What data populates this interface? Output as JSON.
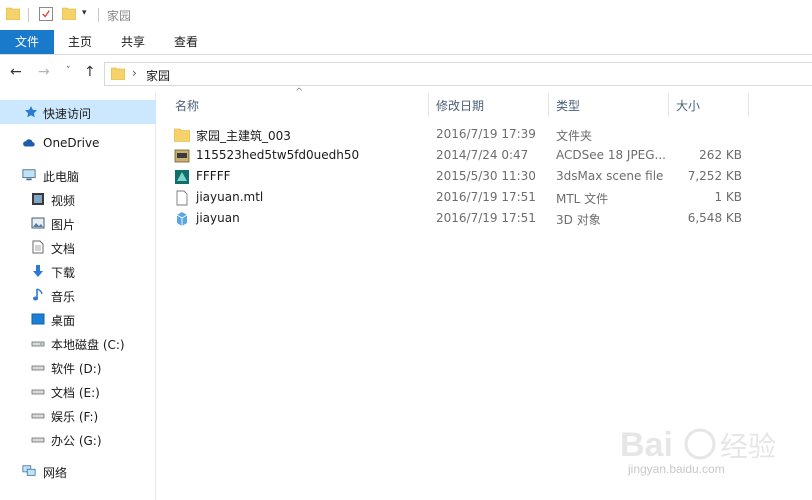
{
  "window": {
    "title": "家园",
    "qat_dropdown": "▾"
  },
  "ribbon": {
    "tabs": [
      "文件",
      "主页",
      "共享",
      "查看"
    ]
  },
  "navigation": {
    "back": "←",
    "forward": "→",
    "recent": "˅",
    "up": "↑",
    "chevron": "›",
    "path": "家园"
  },
  "nav_pane": {
    "items": [
      {
        "label": "快速访问",
        "icon": "star-icon",
        "selected": true
      },
      {
        "label": "OneDrive",
        "icon": "cloud-icon"
      },
      {
        "label": "此电脑",
        "icon": "pc-icon"
      },
      {
        "label": "视频",
        "icon": "video-icon"
      },
      {
        "label": "图片",
        "icon": "picture-icon"
      },
      {
        "label": "文档",
        "icon": "document-icon"
      },
      {
        "label": "下载",
        "icon": "download-icon"
      },
      {
        "label": "音乐",
        "icon": "music-icon"
      },
      {
        "label": "桌面",
        "icon": "desktop-icon"
      },
      {
        "label": "本地磁盘 (C:)",
        "icon": "drive-icon"
      },
      {
        "label": "软件 (D:)",
        "icon": "drive-icon"
      },
      {
        "label": "文档 (E:)",
        "icon": "drive-icon"
      },
      {
        "label": "娱乐 (F:)",
        "icon": "drive-icon"
      },
      {
        "label": "办公 (G:)",
        "icon": "drive-icon"
      },
      {
        "label": "网络",
        "icon": "network-icon"
      }
    ]
  },
  "columns": {
    "name": "名称",
    "date": "修改日期",
    "type": "类型",
    "size": "大小",
    "sort_indicator": "^"
  },
  "files": [
    {
      "name": "家园_主建筑_003",
      "date": "2016/7/19 17:39",
      "type": "文件夹",
      "size": "",
      "icon": "folder-icon"
    },
    {
      "name": "115523hed5tw5fd0uedh50",
      "date": "2014/7/24 0:47",
      "type": "ACDSee 18 JPEG...",
      "size": "262 KB",
      "icon": "jpeg-icon"
    },
    {
      "name": "FFFFF",
      "date": "2015/5/30 11:30",
      "type": "3dsMax scene file",
      "size": "7,252 KB",
      "icon": "3dsmax-icon"
    },
    {
      "name": "jiayuan.mtl",
      "date": "2016/7/19 17:51",
      "type": "MTL 文件",
      "size": "1 KB",
      "icon": "file-icon"
    },
    {
      "name": "jiayuan",
      "date": "2016/7/19 17:51",
      "type": "3D 对象",
      "size": "6,548 KB",
      "icon": "3d-object-icon"
    }
  ],
  "watermark": {
    "logo": "Bai度经验",
    "url": "jingyan.baidu.com"
  },
  "colors": {
    "file_tab": "#1979ca",
    "selection": "#cce8ff",
    "folder": "#f6d36a",
    "header_text": "#4c607a"
  }
}
